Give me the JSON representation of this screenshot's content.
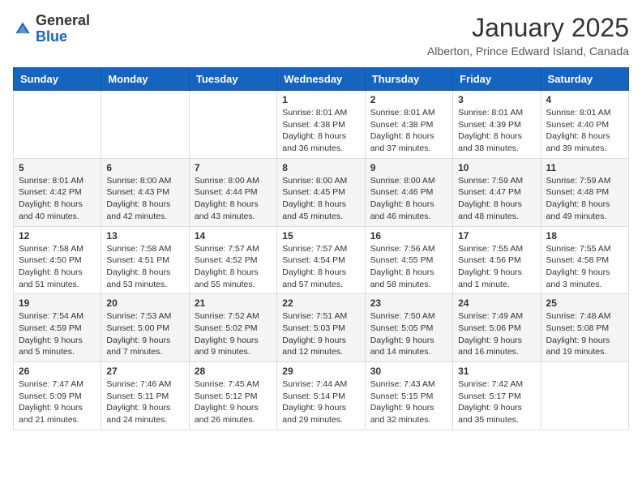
{
  "header": {
    "logo_general": "General",
    "logo_blue": "Blue",
    "month": "January 2025",
    "location": "Alberton, Prince Edward Island, Canada"
  },
  "weekdays": [
    "Sunday",
    "Monday",
    "Tuesday",
    "Wednesday",
    "Thursday",
    "Friday",
    "Saturday"
  ],
  "weeks": [
    [
      {
        "day": "",
        "info": ""
      },
      {
        "day": "",
        "info": ""
      },
      {
        "day": "",
        "info": ""
      },
      {
        "day": "1",
        "info": "Sunrise: 8:01 AM\nSunset: 4:38 PM\nDaylight: 8 hours and 36 minutes."
      },
      {
        "day": "2",
        "info": "Sunrise: 8:01 AM\nSunset: 4:38 PM\nDaylight: 8 hours and 37 minutes."
      },
      {
        "day": "3",
        "info": "Sunrise: 8:01 AM\nSunset: 4:39 PM\nDaylight: 8 hours and 38 minutes."
      },
      {
        "day": "4",
        "info": "Sunrise: 8:01 AM\nSunset: 4:40 PM\nDaylight: 8 hours and 39 minutes."
      }
    ],
    [
      {
        "day": "5",
        "info": "Sunrise: 8:01 AM\nSunset: 4:42 PM\nDaylight: 8 hours and 40 minutes."
      },
      {
        "day": "6",
        "info": "Sunrise: 8:00 AM\nSunset: 4:43 PM\nDaylight: 8 hours and 42 minutes."
      },
      {
        "day": "7",
        "info": "Sunrise: 8:00 AM\nSunset: 4:44 PM\nDaylight: 8 hours and 43 minutes."
      },
      {
        "day": "8",
        "info": "Sunrise: 8:00 AM\nSunset: 4:45 PM\nDaylight: 8 hours and 45 minutes."
      },
      {
        "day": "9",
        "info": "Sunrise: 8:00 AM\nSunset: 4:46 PM\nDaylight: 8 hours and 46 minutes."
      },
      {
        "day": "10",
        "info": "Sunrise: 7:59 AM\nSunset: 4:47 PM\nDaylight: 8 hours and 48 minutes."
      },
      {
        "day": "11",
        "info": "Sunrise: 7:59 AM\nSunset: 4:48 PM\nDaylight: 8 hours and 49 minutes."
      }
    ],
    [
      {
        "day": "12",
        "info": "Sunrise: 7:58 AM\nSunset: 4:50 PM\nDaylight: 8 hours and 51 minutes."
      },
      {
        "day": "13",
        "info": "Sunrise: 7:58 AM\nSunset: 4:51 PM\nDaylight: 8 hours and 53 minutes."
      },
      {
        "day": "14",
        "info": "Sunrise: 7:57 AM\nSunset: 4:52 PM\nDaylight: 8 hours and 55 minutes."
      },
      {
        "day": "15",
        "info": "Sunrise: 7:57 AM\nSunset: 4:54 PM\nDaylight: 8 hours and 57 minutes."
      },
      {
        "day": "16",
        "info": "Sunrise: 7:56 AM\nSunset: 4:55 PM\nDaylight: 8 hours and 58 minutes."
      },
      {
        "day": "17",
        "info": "Sunrise: 7:55 AM\nSunset: 4:56 PM\nDaylight: 9 hours and 1 minute."
      },
      {
        "day": "18",
        "info": "Sunrise: 7:55 AM\nSunset: 4:58 PM\nDaylight: 9 hours and 3 minutes."
      }
    ],
    [
      {
        "day": "19",
        "info": "Sunrise: 7:54 AM\nSunset: 4:59 PM\nDaylight: 9 hours and 5 minutes."
      },
      {
        "day": "20",
        "info": "Sunrise: 7:53 AM\nSunset: 5:00 PM\nDaylight: 9 hours and 7 minutes."
      },
      {
        "day": "21",
        "info": "Sunrise: 7:52 AM\nSunset: 5:02 PM\nDaylight: 9 hours and 9 minutes."
      },
      {
        "day": "22",
        "info": "Sunrise: 7:51 AM\nSunset: 5:03 PM\nDaylight: 9 hours and 12 minutes."
      },
      {
        "day": "23",
        "info": "Sunrise: 7:50 AM\nSunset: 5:05 PM\nDaylight: 9 hours and 14 minutes."
      },
      {
        "day": "24",
        "info": "Sunrise: 7:49 AM\nSunset: 5:06 PM\nDaylight: 9 hours and 16 minutes."
      },
      {
        "day": "25",
        "info": "Sunrise: 7:48 AM\nSunset: 5:08 PM\nDaylight: 9 hours and 19 minutes."
      }
    ],
    [
      {
        "day": "26",
        "info": "Sunrise: 7:47 AM\nSunset: 5:09 PM\nDaylight: 9 hours and 21 minutes."
      },
      {
        "day": "27",
        "info": "Sunrise: 7:46 AM\nSunset: 5:11 PM\nDaylight: 9 hours and 24 minutes."
      },
      {
        "day": "28",
        "info": "Sunrise: 7:45 AM\nSunset: 5:12 PM\nDaylight: 9 hours and 26 minutes."
      },
      {
        "day": "29",
        "info": "Sunrise: 7:44 AM\nSunset: 5:14 PM\nDaylight: 9 hours and 29 minutes."
      },
      {
        "day": "30",
        "info": "Sunrise: 7:43 AM\nSunset: 5:15 PM\nDaylight: 9 hours and 32 minutes."
      },
      {
        "day": "31",
        "info": "Sunrise: 7:42 AM\nSunset: 5:17 PM\nDaylight: 9 hours and 35 minutes."
      },
      {
        "day": "",
        "info": ""
      }
    ]
  ]
}
